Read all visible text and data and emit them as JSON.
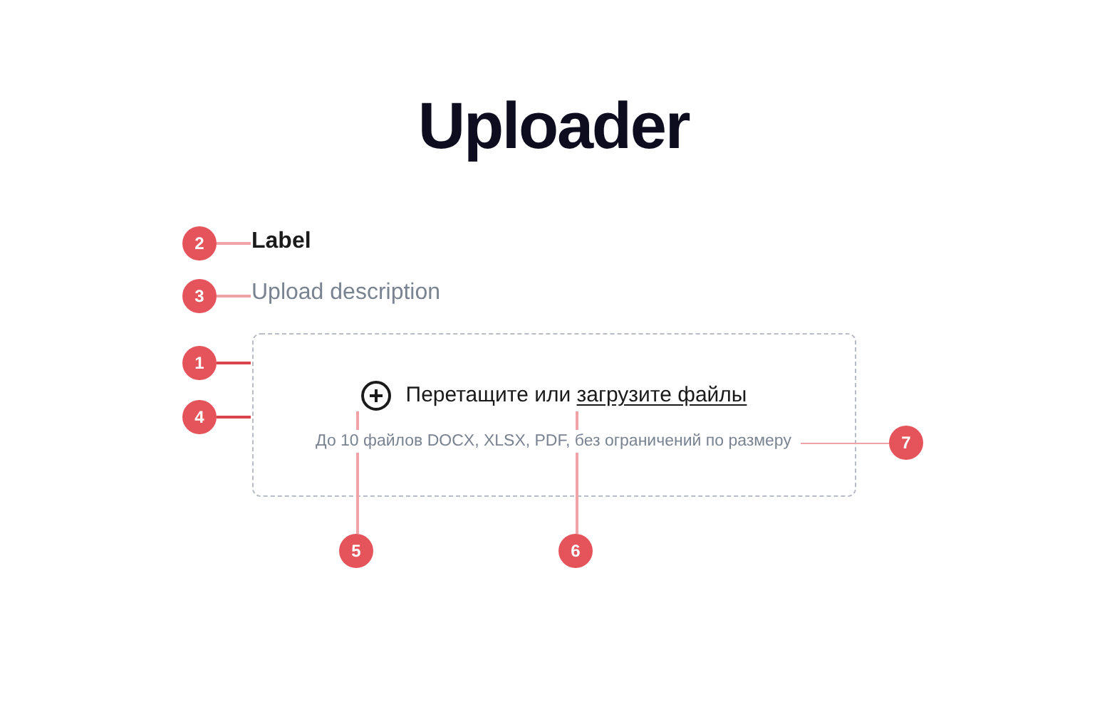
{
  "title": "Uploader",
  "field": {
    "label": "Label",
    "description": "Upload description"
  },
  "dropzone": {
    "text": "Перетащите или",
    "link": "загрузите файлы",
    "hint": "До 10 файлов DOCX, XLSX, PDF, без ограничений по размеру"
  },
  "annotations": [
    "2",
    "3",
    "1",
    "4",
    "5",
    "6",
    "7"
  ]
}
